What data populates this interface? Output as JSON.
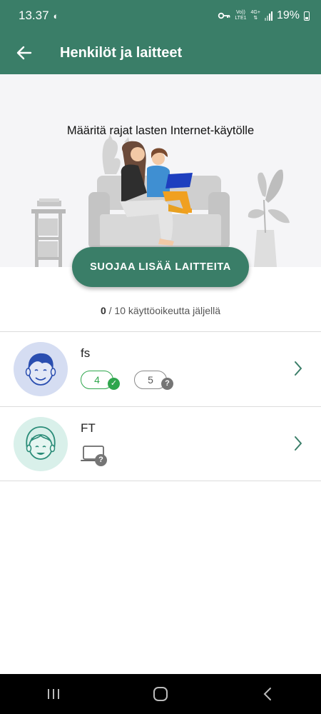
{
  "status_bar": {
    "time": "13.37",
    "network_top": "Vo))",
    "network_bottom": "LTE1",
    "network_type": "4G+",
    "battery": "19%"
  },
  "app_bar": {
    "title": "Henkilöt ja laitteet",
    "back_icon": "arrow-left-icon"
  },
  "hero": {
    "text": "Määritä rajat lasten Internet-käytölle"
  },
  "cta": {
    "label": "SUOJAA LISÄÄ LAITTEITA"
  },
  "licenses": {
    "used": "0",
    "rest": " / 10 käyttöoikeutta jäljellä"
  },
  "profiles": [
    {
      "name": "fs",
      "avatar_icon": "boy-avatar-icon",
      "devices": [
        {
          "count": "4",
          "status": "protected",
          "status_icon": "check-icon"
        },
        {
          "count": "5",
          "status": "unknown",
          "status_icon": "question-icon"
        }
      ]
    },
    {
      "name": "FT",
      "avatar_icon": "girl-avatar-icon",
      "devices": [
        {
          "device_icon": "laptop-icon",
          "status": "unknown",
          "status_icon": "question-icon"
        }
      ]
    }
  ],
  "colors": {
    "primary": "#3a7e68",
    "green": "#2fa64d",
    "gray_badge": "#757575",
    "hero_bg": "#f5f5f7"
  }
}
